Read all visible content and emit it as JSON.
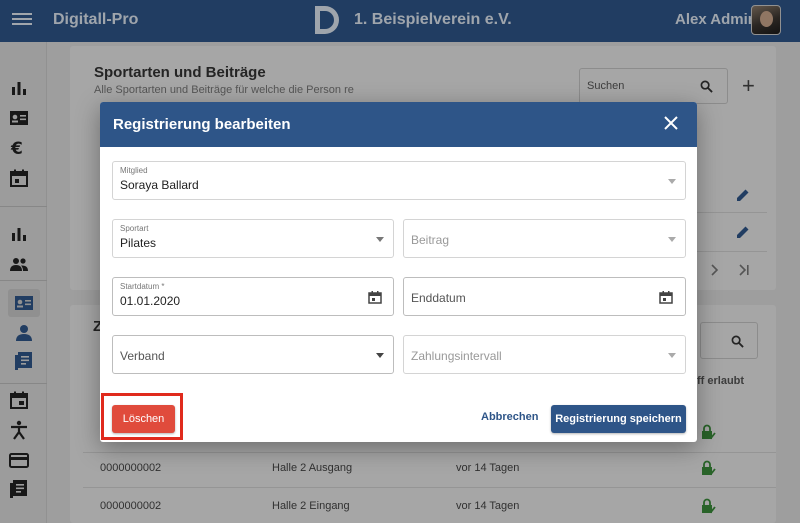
{
  "topbar": {
    "app_name": "Digitall-Pro",
    "club_name": "1. Beispielverein e.V.",
    "user_name": "Alex Admin"
  },
  "background": {
    "section_title": "Sportarten und Beiträge",
    "section_subtitle": "Alle Sportarten und Beiträge für welche die Person re",
    "search_placeholder": "Suchen",
    "section2_letter": "Z",
    "column_header_right": "ff erlaubt",
    "rows": [
      {
        "id": "0000000002",
        "door": "Halle 2 Ausgang",
        "time": "vor 14 Tagen"
      },
      {
        "id": "0000000002",
        "door": "Halle 2 Eingang",
        "time": "vor 14 Tagen"
      }
    ]
  },
  "dialog": {
    "title": "Registrierung bearbeiten",
    "member": {
      "label": "Mitglied",
      "value": "Soraya Ballard"
    },
    "sport": {
      "label": "Sportart",
      "value": "Pilates"
    },
    "fee": {
      "placeholder": "Beitrag"
    },
    "start_date": {
      "label": "Startdatum *",
      "value": "01.01.2020"
    },
    "end_date": {
      "placeholder": "Enddatum"
    },
    "association": {
      "placeholder": "Verband"
    },
    "payment_interval": {
      "placeholder": "Zahlungsintervall"
    },
    "delete_label": "Löschen",
    "cancel_label": "Abbrechen",
    "save_label": "Registrierung speichern"
  },
  "colors": {
    "primary": "#2e5588",
    "danger": "#e04b3c",
    "highlight": "#e02a1d",
    "success": "#3a8a3a"
  }
}
